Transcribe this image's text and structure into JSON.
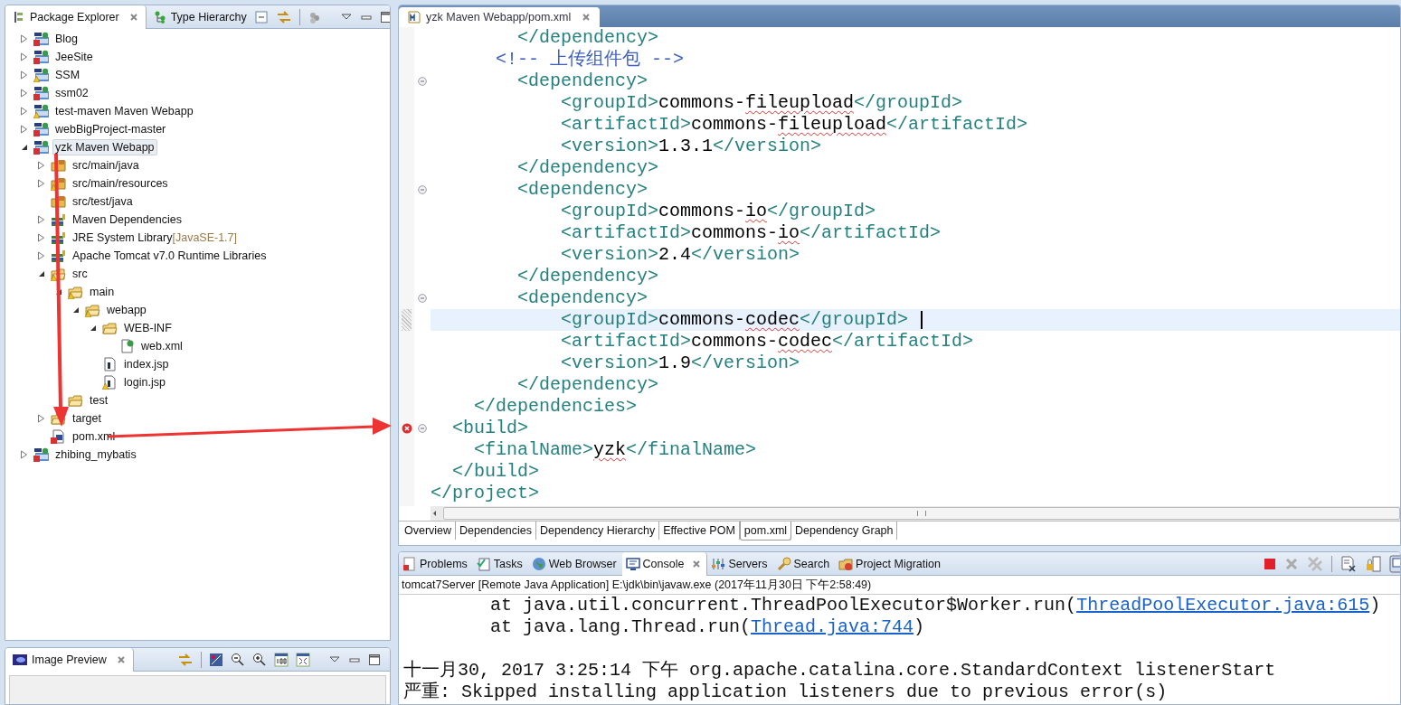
{
  "package_explorer": {
    "tabs": [
      {
        "label": "Package Explorer",
        "selected": true
      },
      {
        "label": "Type Hierarchy",
        "selected": false
      }
    ],
    "tree": [
      {
        "label": "Blog",
        "kind": "project",
        "error": true,
        "warning": false,
        "expanded": false,
        "selected": false
      },
      {
        "label": "JeeSite",
        "kind": "project",
        "error": true,
        "warning": false,
        "expanded": false,
        "selected": false
      },
      {
        "label": "SSM",
        "kind": "project",
        "error": false,
        "warning": true,
        "expanded": false,
        "selected": false
      },
      {
        "label": "ssm02",
        "kind": "project",
        "error": true,
        "warning": false,
        "expanded": false,
        "selected": false
      },
      {
        "label": "test-maven Maven Webapp",
        "kind": "project",
        "error": false,
        "warning": true,
        "expanded": false,
        "selected": false
      },
      {
        "label": "webBigProject-master",
        "kind": "project",
        "error": true,
        "warning": false,
        "expanded": false,
        "selected": false
      },
      {
        "label": "yzk Maven Webapp",
        "kind": "project",
        "error": true,
        "warning": false,
        "expanded": true,
        "selected": true,
        "children": [
          {
            "label": "src/main/java",
            "kind": "source-folder",
            "error": false,
            "warning": false,
            "expanded": false,
            "selected": false
          },
          {
            "label": "src/main/resources",
            "kind": "source-folder",
            "error": false,
            "warning": true,
            "expanded": false,
            "selected": false
          },
          {
            "label": "src/test/java",
            "kind": "source-folder",
            "error": false,
            "warning": false,
            "selected": false
          },
          {
            "label": "Maven Dependencies",
            "kind": "library",
            "error": false,
            "warning": false,
            "expanded": false,
            "selected": false
          },
          {
            "label": "JRE System Library",
            "decoration": "[JavaSE-1.7]",
            "kind": "library",
            "error": false,
            "warning": false,
            "expanded": false,
            "selected": false
          },
          {
            "label": "Apache Tomcat v7.0 Runtime Libraries",
            "kind": "library",
            "error": false,
            "warning": false,
            "expanded": false,
            "selected": false
          },
          {
            "label": "src",
            "kind": "folder",
            "error": false,
            "warning": true,
            "expanded": true,
            "selected": false,
            "children": [
              {
                "label": "main",
                "kind": "folder",
                "error": false,
                "warning": true,
                "expanded": true,
                "selected": false,
                "children": [
                  {
                    "label": "webapp",
                    "kind": "folder",
                    "error": false,
                    "warning": true,
                    "expanded": true,
                    "selected": false,
                    "children": [
                      {
                        "label": "WEB-INF",
                        "kind": "folder",
                        "error": false,
                        "warning": false,
                        "expanded": true,
                        "selected": false,
                        "children": [
                          {
                            "label": "web.xml",
                            "kind": "xml",
                            "error": false,
                            "warning": false,
                            "selected": false
                          }
                        ]
                      },
                      {
                        "label": "index.jsp",
                        "kind": "jsp",
                        "error": false,
                        "warning": false,
                        "selected": false
                      },
                      {
                        "label": "login.jsp",
                        "kind": "jsp",
                        "error": false,
                        "warning": true,
                        "selected": false
                      }
                    ]
                  }
                ]
              },
              {
                "label": "test",
                "kind": "folder",
                "error": false,
                "warning": false,
                "selected": false
              }
            ]
          },
          {
            "label": "target",
            "kind": "folder",
            "error": false,
            "warning": false,
            "expanded": false,
            "selected": false
          },
          {
            "label": "pom.xml",
            "kind": "pom",
            "error": true,
            "warning": false,
            "selected": false
          }
        ]
      },
      {
        "label": "zhibing_mybatis",
        "kind": "project",
        "error": true,
        "warning": false,
        "expanded": false,
        "selected": false
      }
    ]
  },
  "editor": {
    "tabs": [
      {
        "label": "yzk Maven Webapp/pom.xml",
        "selected": true
      }
    ],
    "lines": [
      {
        "fold": false,
        "error": false,
        "current": false,
        "tokens": [
          {
            "kind": "tag",
            "text": "        </dependency>"
          }
        ]
      },
      {
        "fold": false,
        "error": false,
        "current": false,
        "tokens": [
          {
            "kind": "comment",
            "text": "      <!-- 上传组件包 -->"
          }
        ]
      },
      {
        "fold": true,
        "error": false,
        "current": false,
        "tokens": [
          {
            "kind": "tag",
            "text": "        <dependency>"
          }
        ]
      },
      {
        "fold": false,
        "error": false,
        "current": false,
        "tokens": [
          {
            "kind": "tag",
            "text": "            <groupId>"
          },
          {
            "kind": "text",
            "text": "commons-"
          },
          {
            "kind": "typo",
            "text": "fileupload"
          },
          {
            "kind": "tag",
            "text": "</groupId>"
          }
        ]
      },
      {
        "fold": false,
        "error": false,
        "current": false,
        "tokens": [
          {
            "kind": "tag",
            "text": "            <artifactId>"
          },
          {
            "kind": "text",
            "text": "commons-"
          },
          {
            "kind": "typo",
            "text": "fileupload"
          },
          {
            "kind": "tag",
            "text": "</artifactId>"
          }
        ]
      },
      {
        "fold": false,
        "error": false,
        "current": false,
        "tokens": [
          {
            "kind": "tag",
            "text": "            <version>"
          },
          {
            "kind": "text",
            "text": "1.3.1"
          },
          {
            "kind": "tag",
            "text": "</version>"
          }
        ]
      },
      {
        "fold": false,
        "error": false,
        "current": false,
        "tokens": [
          {
            "kind": "tag",
            "text": "        </dependency>"
          }
        ]
      },
      {
        "fold": true,
        "error": false,
        "current": false,
        "tokens": [
          {
            "kind": "tag",
            "text": "        <dependency>"
          }
        ]
      },
      {
        "fold": false,
        "error": false,
        "current": false,
        "tokens": [
          {
            "kind": "tag",
            "text": "            <groupId>"
          },
          {
            "kind": "text",
            "text": "commons-"
          },
          {
            "kind": "typo",
            "text": "io"
          },
          {
            "kind": "tag",
            "text": "</groupId>"
          }
        ]
      },
      {
        "fold": false,
        "error": false,
        "current": false,
        "tokens": [
          {
            "kind": "tag",
            "text": "            <artifactId>"
          },
          {
            "kind": "text",
            "text": "commons-"
          },
          {
            "kind": "typo",
            "text": "io"
          },
          {
            "kind": "tag",
            "text": "</artifactId>"
          }
        ]
      },
      {
        "fold": false,
        "error": false,
        "current": false,
        "tokens": [
          {
            "kind": "tag",
            "text": "            <version>"
          },
          {
            "kind": "text",
            "text": "2.4"
          },
          {
            "kind": "tag",
            "text": "</version>"
          }
        ]
      },
      {
        "fold": false,
        "error": false,
        "current": false,
        "tokens": [
          {
            "kind": "tag",
            "text": "        </dependency>"
          }
        ]
      },
      {
        "fold": true,
        "error": false,
        "current": false,
        "tokens": [
          {
            "kind": "tag",
            "text": "        <dependency>"
          }
        ]
      },
      {
        "fold": false,
        "error": false,
        "current": true,
        "tokens": [
          {
            "kind": "tag",
            "text": "            <groupId>"
          },
          {
            "kind": "text",
            "text": "commons-"
          },
          {
            "kind": "typo",
            "text": "codec"
          },
          {
            "kind": "tag",
            "text": "</groupId>"
          }
        ]
      },
      {
        "fold": false,
        "error": false,
        "current": false,
        "tokens": [
          {
            "kind": "tag",
            "text": "            <artifactId>"
          },
          {
            "kind": "text",
            "text": "commons-"
          },
          {
            "kind": "typo",
            "text": "codec"
          },
          {
            "kind": "tag",
            "text": "</artifactId>"
          }
        ]
      },
      {
        "fold": false,
        "error": false,
        "current": false,
        "tokens": [
          {
            "kind": "tag",
            "text": "            <version>"
          },
          {
            "kind": "text",
            "text": "1.9"
          },
          {
            "kind": "tag",
            "text": "</version>"
          }
        ]
      },
      {
        "fold": false,
        "error": false,
        "current": false,
        "tokens": [
          {
            "kind": "tag",
            "text": "        </dependency>"
          }
        ]
      },
      {
        "fold": false,
        "error": false,
        "current": false,
        "tokens": [
          {
            "kind": "tag",
            "text": "    </dependencies>"
          }
        ]
      },
      {
        "fold": true,
        "error": true,
        "current": false,
        "tokens": [
          {
            "kind": "tag",
            "text": "  <build>"
          }
        ]
      },
      {
        "fold": false,
        "error": false,
        "current": false,
        "tokens": [
          {
            "kind": "tag",
            "text": "    <finalName>"
          },
          {
            "kind": "typo",
            "text": "yzk"
          },
          {
            "kind": "tag",
            "text": "</finalName>"
          }
        ]
      },
      {
        "fold": false,
        "error": false,
        "current": false,
        "tokens": [
          {
            "kind": "tag",
            "text": "  </build>"
          }
        ]
      },
      {
        "fold": false,
        "error": false,
        "current": false,
        "tokens": [
          {
            "kind": "tag",
            "text": "</project>"
          }
        ]
      }
    ],
    "page_tabs": [
      {
        "label": "Overview",
        "selected": false
      },
      {
        "label": "Dependencies",
        "selected": false
      },
      {
        "label": "Dependency Hierarchy",
        "selected": false
      },
      {
        "label": "Effective POM",
        "selected": false
      },
      {
        "label": "pom.xml",
        "selected": true
      },
      {
        "label": "Dependency Graph",
        "selected": false
      }
    ]
  },
  "console_view": {
    "tabs": [
      {
        "label": "Problems",
        "kind": "problems",
        "selected": false
      },
      {
        "label": "Tasks",
        "kind": "tasks",
        "selected": false
      },
      {
        "label": "Web Browser",
        "kind": "globe",
        "selected": false
      },
      {
        "label": "Console",
        "kind": "console",
        "selected": true
      },
      {
        "label": "Servers",
        "kind": "servers",
        "selected": false
      },
      {
        "label": "Search",
        "kind": "search",
        "selected": false
      },
      {
        "label": "Project Migration",
        "kind": "migration",
        "selected": false
      }
    ],
    "process": "tomcat7Server [Remote Java Application] E:\\jdk\\bin\\javaw.exe (2017年11月30日 下午2:58:49)",
    "blocks": [
      {
        "lines": [
          {
            "tokens": [
              {
                "kind": "text",
                "text": "        at java.util.concurrent.ThreadPoolExecutor$Worker.run("
              },
              {
                "kind": "link",
                "text": "ThreadPoolExecutor.java:615"
              },
              {
                "kind": "text",
                "text": ")"
              }
            ]
          },
          {
            "tokens": [
              {
                "kind": "text",
                "text": "        at java.lang.Thread.run("
              },
              {
                "kind": "link",
                "text": "Thread.java:744"
              },
              {
                "kind": "text",
                "text": ")"
              }
            ]
          }
        ]
      },
      {
        "lines": [
          {
            "tokens": [
              {
                "kind": "text",
                "text": "十一月30, 2017 3:25:14 下午 org.apache.catalina.core.StandardContext listenerStart"
              }
            ]
          },
          {
            "tokens": [
              {
                "kind": "text",
                "text": "严重: Skipped installing application listeners due to previous error(s)"
              }
            ]
          }
        ]
      }
    ]
  },
  "image_preview": {
    "tabs": [
      {
        "label": "Image Preview",
        "selected": true
      }
    ]
  }
}
